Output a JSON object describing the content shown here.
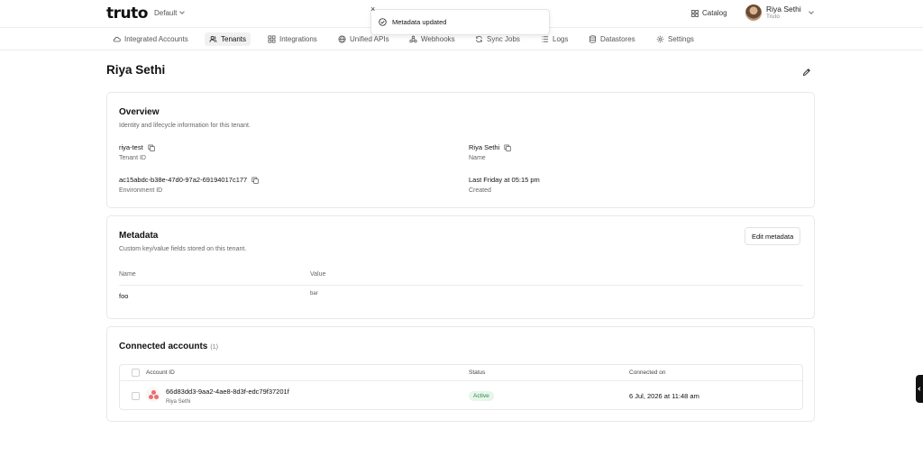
{
  "app": {
    "logo": "truto",
    "workspace": "Default"
  },
  "header": {
    "catalog_label": "Catalog",
    "user_name": "Riya Sethi",
    "user_org": "Truto"
  },
  "toast": {
    "message": "Metadata updated"
  },
  "nav": {
    "tabs": [
      {
        "label": "Integrated Accounts",
        "icon": "cloud-icon",
        "active": false
      },
      {
        "label": "Tenants",
        "icon": "users-icon",
        "active": true
      },
      {
        "label": "Integrations",
        "icon": "grid-icon",
        "active": false
      },
      {
        "label": "Unified APIs",
        "icon": "globe-icon",
        "active": false
      },
      {
        "label": "Webhooks",
        "icon": "webhook-icon",
        "active": false
      },
      {
        "label": "Sync Jobs",
        "icon": "sync-icon",
        "active": false
      },
      {
        "label": "Logs",
        "icon": "list-icon",
        "active": false
      },
      {
        "label": "Datastores",
        "icon": "database-icon",
        "active": false
      },
      {
        "label": "Settings",
        "icon": "gear-icon",
        "active": false
      }
    ]
  },
  "page": {
    "title": "Riya Sethi"
  },
  "overview": {
    "title": "Overview",
    "description": "Identity and lifecycle information for this tenant.",
    "fields": {
      "tenant_id": {
        "value": "riya-test",
        "label": "Tenant ID"
      },
      "name": {
        "value": "Riya Sethi",
        "label": "Name"
      },
      "environment_id": {
        "value": "ac15abdc-b38e-47d0-97a2-69194017c177",
        "label": "Environment ID"
      },
      "created": {
        "value": "Last Friday at 05:15 pm",
        "label": "Created"
      }
    }
  },
  "metadata": {
    "title": "Metadata",
    "description": "Custom key/value fields stored on this tenant.",
    "edit_label": "Edit metadata",
    "columns": [
      "Name",
      "Value"
    ],
    "rows": [
      {
        "name": "foo",
        "value": "bar"
      }
    ]
  },
  "connected_accounts": {
    "title": "Connected accounts",
    "count": "(1)",
    "columns": [
      "Account ID",
      "Status",
      "Connected on"
    ],
    "rows": [
      {
        "account_id": "66d83dd3-9aa2-4ae8-8d3f-edc79f37201f",
        "tenant": "Riya Sethi",
        "status": "Active",
        "connected_on": "6 Jul, 2026 at 11:48 am"
      }
    ]
  },
  "colors": {
    "accent_active_badge_bg": "#e6f6ea",
    "accent_active_badge_text": "#2f8a46",
    "integration_logo": "#f06a6a"
  }
}
